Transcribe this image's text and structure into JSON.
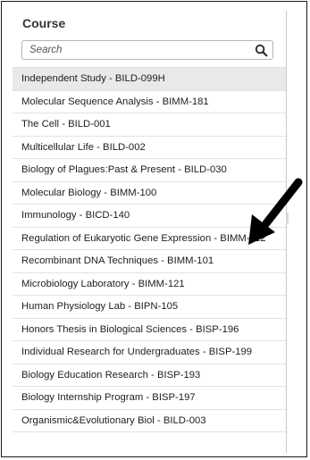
{
  "panel": {
    "title": "Course"
  },
  "search": {
    "placeholder": "Search",
    "value": ""
  },
  "icons": {
    "search": "search-icon",
    "annotation_arrow": "arrow-pointer-icon"
  },
  "colors": {
    "selected_row": "#e9e9e9",
    "row_divider": "#e2e2e2",
    "text": "#1e1e1e",
    "arrow": "#000000"
  },
  "courses": {
    "items": [
      {
        "label": "Independent Study - BILD-099H",
        "selected": true
      },
      {
        "label": "Molecular Sequence Analysis - BIMM-181"
      },
      {
        "label": "The Cell - BILD-001"
      },
      {
        "label": "Multicellular Life - BILD-002"
      },
      {
        "label": "Biology of Plagues:Past & Present - BILD-030"
      },
      {
        "label": "Molecular Biology - BIMM-100"
      },
      {
        "label": "Immunology - BICD-140"
      },
      {
        "label": "Regulation of Eukaryotic Gene Expression - BIMM-112"
      },
      {
        "label": "Recombinant DNA Techniques - BIMM-101"
      },
      {
        "label": "Microbiology Laboratory - BIMM-121"
      },
      {
        "label": "Human Physiology Lab - BIPN-105"
      },
      {
        "label": "Honors Thesis in Biological Sciences - BISP-196"
      },
      {
        "label": "Individual Research for Undergraduates - BISP-199"
      },
      {
        "label": "Biology Education Research - BISP-193"
      },
      {
        "label": "Biology Internship Program - BISP-197"
      },
      {
        "label": "Organismic&Evolutionary Biol - BILD-003"
      }
    ]
  }
}
